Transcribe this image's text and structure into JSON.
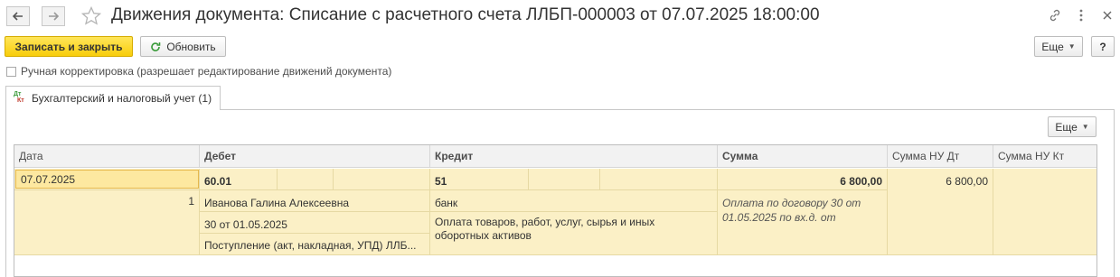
{
  "window": {
    "title": "Движения документа: Списание с расчетного счета ЛЛБП-000003 от 07.07.2025 18:00:00",
    "icons": [
      "back-icon",
      "forward-icon",
      "star-icon",
      "link-icon",
      "more-vertical-icon",
      "close-icon"
    ]
  },
  "toolbar": {
    "save_close_label": "Записать и закрыть",
    "refresh_label": "Обновить",
    "more_label": "Еще",
    "help_label": "?"
  },
  "manual_correction": {
    "label": "Ручная корректировка (разрешает редактирование движений документа)",
    "checked": false
  },
  "tabs": [
    {
      "label": "Бухгалтерский и налоговый учет (1)",
      "icon_text_top": "Дт",
      "icon_text_bottom": "Кт"
    }
  ],
  "table_toolbar": {
    "more_label": "Еще"
  },
  "table": {
    "columns": [
      "Дата",
      "Дебет",
      "Кредит",
      "Сумма",
      "Сумма НУ Дт",
      "Сумма НУ Кт"
    ],
    "rows": [
      {
        "date": "07.07.2025",
        "line_number": "1",
        "debit_account": "60.01",
        "debit_subconto": [
          "Иванова Галина Алексеевна",
          "30 от 01.05.2025",
          "Поступление (акт, накладная, УПД) ЛЛБ..."
        ],
        "credit_account": "51",
        "credit_subconto": [
          "банк",
          "Оплата товаров, работ, услуг, сырья и иных оборотных активов"
        ],
        "amount": "6 800,00",
        "content": "Оплата по договору 30 от 01.05.2025 по вх.д.  от",
        "amount_nu_dt": "6 800,00",
        "amount_nu_kt": ""
      }
    ]
  }
}
